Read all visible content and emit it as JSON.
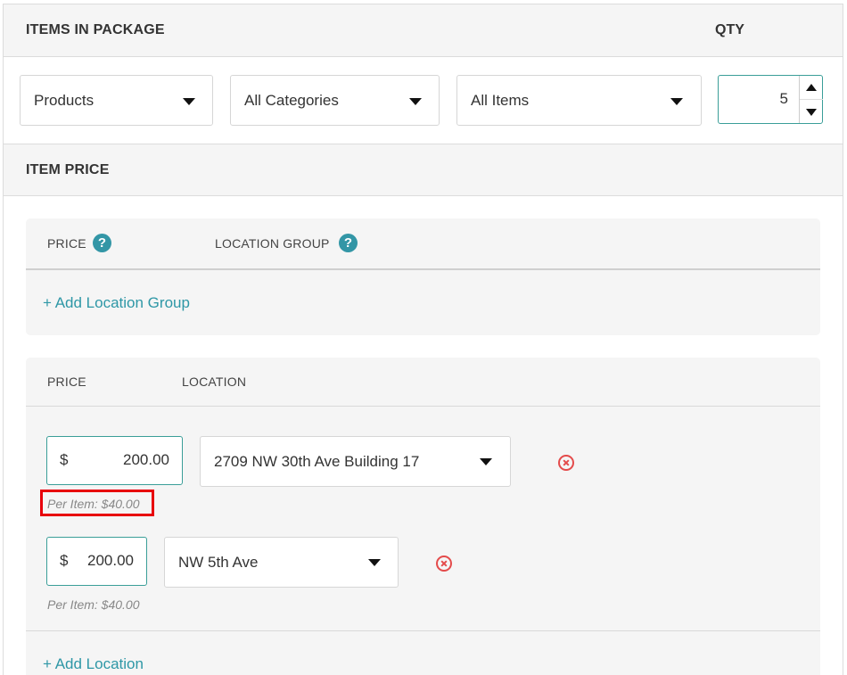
{
  "items_in_package": {
    "title": "ITEMS IN PACKAGE",
    "qty_label": "QTY",
    "product_type_select": "Products",
    "category_select": "All Categories",
    "item_select": "All Items",
    "quantity": "5"
  },
  "item_price": {
    "title": "ITEM PRICE",
    "location_group_section": {
      "price_header": "PRICE",
      "location_group_header": "LOCATION GROUP",
      "add_link": "+ Add Location Group"
    },
    "location_section": {
      "price_header": "PRICE",
      "location_header": "LOCATION",
      "rows": [
        {
          "currency": "$",
          "price": "200.00",
          "location": "2709 NW 30th Ave Building 17",
          "per_item": "Per Item: $40.00"
        },
        {
          "currency": "$",
          "price": "200.00",
          "location": "NW 5th Ave",
          "per_item": "Per Item: $40.00"
        }
      ],
      "add_link": "+ Add Location"
    }
  },
  "colors": {
    "accent_teal": "#3a9e98",
    "link_blue": "#2e97a6",
    "remove_red": "#e44b4b",
    "highlight_red": "#e8000b"
  },
  "icons": {
    "help": "question-circle",
    "remove": "x-circle",
    "dropdown": "caret-down",
    "spinner_up": "caret-up",
    "spinner_down": "caret-down"
  }
}
